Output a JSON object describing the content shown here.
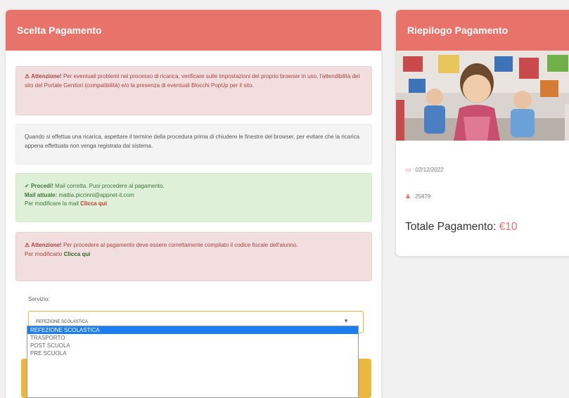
{
  "left_panel": {
    "title": "Scelta Pagamento",
    "alert1": {
      "strong": "Attenzione!",
      "text": " Per eventuali problemi nel processo di ricarica, verificare sulle impostazioni del proprio browser in uso, l'attendibilità del sito del Portale Genitori (compatibilità) e/o la presenza di eventuali Blocchi PopUp per il sito."
    },
    "info": "Quando si effettua una ricarica, aspettare il termine della procedura prima di chiudere le finestre del browser, per evitare che la ricarica appena effettuata non venga registrata dal sistema.",
    "success": {
      "strong": "Procedi!",
      "text": " Mail corretta. Puoi procedere al pagamento.",
      "mail_label": "Mail attuale:",
      "mail_value": " mattia.piccinni@appnet-it.com",
      "modify_text": "Per modificare la mail ",
      "modify_link": "Clicca qui"
    },
    "alert2": {
      "strong": "Attenzione!",
      "text": " Per procedere al pagamento deve essere correttamente compilato il codice fiscale dell'alunno.",
      "modify_text": "Per modificarlo ",
      "modify_link": "Clicca qui"
    },
    "select": {
      "label": "Servizio:",
      "value": "REFEZIONE SCOLASTICA",
      "options": [
        "REFEZIONE SCOLASTICA",
        "TRASPORTO",
        "POST SCUOLA",
        "PRE SCUOLA"
      ]
    }
  },
  "right_panel": {
    "title": "Riepilogo Pagamento",
    "date": "02/12/2022",
    "code": "25879",
    "total_label": "Totale Pagamento:",
    "total_value": "€10"
  },
  "icons": {
    "warning": "warning-triangle-icon",
    "check": "check-icon",
    "calendar": "calendar-icon",
    "user": "user-icon",
    "caret": "caret-down-icon"
  },
  "colors": {
    "header": "#e8736b",
    "danger_bg": "#f2dede",
    "success_bg": "#dff0d8",
    "select_border": "#e0b84a",
    "button": "#e8b93e",
    "option_selected": "#1c7ef0"
  }
}
